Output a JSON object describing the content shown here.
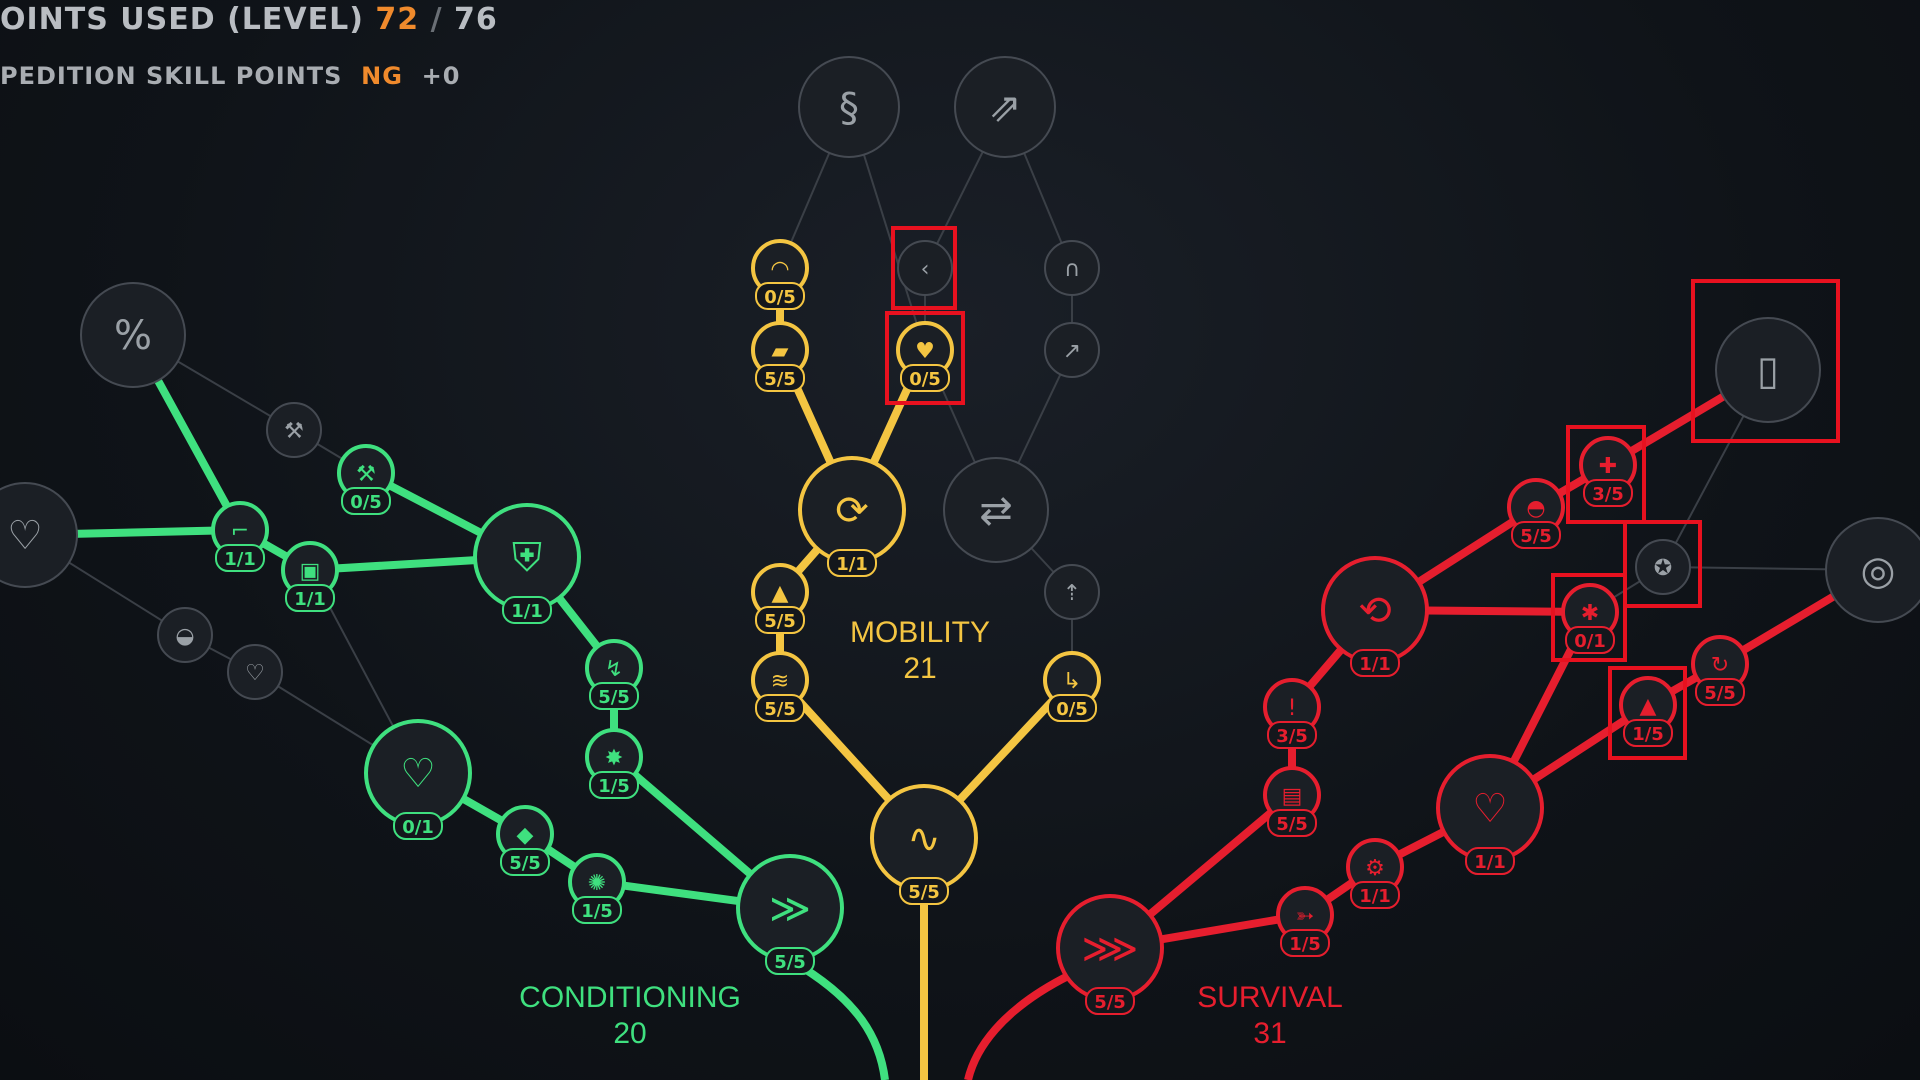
{
  "hud": {
    "points_label": "OINTS USED (LEVEL)",
    "points_used": "72",
    "points_sep": "/",
    "points_total": "76",
    "exp_label": "PEDITION SKILL POINTS",
    "exp_value": "NG",
    "exp_bonus": "+0"
  },
  "branches": {
    "mobility": {
      "name": "MOBILITY",
      "points": "21"
    },
    "conditioning": {
      "name": "CONDITIONING",
      "points": "20"
    },
    "survival": {
      "name": "SURVIVAL",
      "points": "31"
    }
  },
  "colors": {
    "mobility": "#f4c542",
    "conditioning": "#3fe07f",
    "survival": "#e61e2e",
    "locked": "#4a4f57",
    "highlight_box": "#e8111f"
  },
  "nodes": [
    {
      "id": "m-top-left",
      "branch": "locked",
      "icon": "zigzag-s-icon",
      "label": ""
    },
    {
      "id": "m-top-right",
      "branch": "locked",
      "icon": "dash-arrow-icon",
      "label": ""
    },
    {
      "id": "m1",
      "branch": "mobility",
      "icon": "arc-icon",
      "label": "0/5"
    },
    {
      "id": "m2",
      "branch": "locked",
      "icon": "chevron-left-icon",
      "label": ""
    },
    {
      "id": "m3",
      "branch": "locked",
      "icon": "magnet-icon",
      "label": ""
    },
    {
      "id": "m4",
      "branch": "mobility",
      "icon": "shoe-icon",
      "label": "5/5"
    },
    {
      "id": "m5",
      "branch": "mobility",
      "icon": "heart-wing-icon",
      "label": "0/5"
    },
    {
      "id": "m6",
      "branch": "locked",
      "icon": "pin-icon",
      "label": ""
    },
    {
      "id": "m-big-1",
      "branch": "mobility",
      "icon": "swirl-arrow-icon",
      "label": "1/1"
    },
    {
      "id": "m-big-2",
      "branch": "locked",
      "icon": "cycle-arrow-icon",
      "label": ""
    },
    {
      "id": "m7",
      "branch": "mobility",
      "icon": "boot-icon",
      "label": "5/5"
    },
    {
      "id": "m8",
      "branch": "locked",
      "icon": "jump-icon",
      "label": ""
    },
    {
      "id": "m9",
      "branch": "mobility",
      "icon": "coil-icon",
      "label": "5/5"
    },
    {
      "id": "m10",
      "branch": "mobility",
      "icon": "slide-icon",
      "label": "0/5"
    },
    {
      "id": "m-root",
      "branch": "mobility",
      "icon": "wave-arrow-icon",
      "label": "5/5"
    },
    {
      "id": "c-top",
      "branch": "locked",
      "icon": "percent-icon",
      "label": ""
    },
    {
      "id": "c-heart-left",
      "branch": "locked",
      "icon": "heart-shield-icon",
      "label": ""
    },
    {
      "id": "c1",
      "branch": "locked",
      "icon": "pickaxe-icon",
      "label": ""
    },
    {
      "id": "c2",
      "branch": "conditioning",
      "icon": "hammer-icon",
      "label": "0/5"
    },
    {
      "id": "c3",
      "branch": "conditioning",
      "icon": "pistol-icon",
      "label": "1/1"
    },
    {
      "id": "c4",
      "branch": "conditioning",
      "icon": "crate-icon",
      "label": "1/1"
    },
    {
      "id": "c-big-shield",
      "branch": "conditioning",
      "icon": "shield-icon",
      "label": "1/1"
    },
    {
      "id": "c5",
      "branch": "locked",
      "icon": "turtle-icon",
      "label": ""
    },
    {
      "id": "c6",
      "branch": "locked",
      "icon": "heart-icon",
      "label": ""
    },
    {
      "id": "c7",
      "branch": "conditioning",
      "icon": "leap-icon",
      "label": "5/5"
    },
    {
      "id": "c8",
      "branch": "conditioning",
      "icon": "spike-icon",
      "label": "1/5"
    },
    {
      "id": "c-big-heart",
      "branch": "conditioning",
      "icon": "heart-split-icon",
      "label": "0/1"
    },
    {
      "id": "c9",
      "branch": "conditioning",
      "icon": "gem-icon",
      "label": "5/5"
    },
    {
      "id": "c10",
      "branch": "conditioning",
      "icon": "sun-icon",
      "label": "1/5"
    },
    {
      "id": "c-root",
      "branch": "conditioning",
      "icon": "feather-icon",
      "label": "5/5"
    },
    {
      "id": "s-top",
      "branch": "locked",
      "icon": "door-icon",
      "label": ""
    },
    {
      "id": "s-right",
      "branch": "locked",
      "icon": "target-icon",
      "label": ""
    },
    {
      "id": "s1",
      "branch": "survival",
      "icon": "medkit-icon",
      "label": "3/5"
    },
    {
      "id": "s2",
      "branch": "survival",
      "icon": "helmet-icon",
      "label": "5/5"
    },
    {
      "id": "s3",
      "branch": "locked",
      "icon": "badge-icon",
      "label": ""
    },
    {
      "id": "s-big-1",
      "branch": "survival",
      "icon": "reload-icon",
      "label": "1/1"
    },
    {
      "id": "s4",
      "branch": "survival",
      "icon": "bug-icon",
      "label": "0/1"
    },
    {
      "id": "s5",
      "branch": "survival",
      "icon": "spin-icon",
      "label": "5/5"
    },
    {
      "id": "s6",
      "branch": "survival",
      "icon": "alert-icon",
      "label": "3/5"
    },
    {
      "id": "s7",
      "branch": "survival",
      "icon": "flame-icon",
      "label": "1/5"
    },
    {
      "id": "s8",
      "branch": "survival",
      "icon": "bag-icon",
      "label": "5/5"
    },
    {
      "id": "s-big-heart",
      "branch": "survival",
      "icon": "heart-pulse-icon",
      "label": "1/1"
    },
    {
      "id": "s9",
      "branch": "survival",
      "icon": "wrench-icon",
      "label": "1/1"
    },
    {
      "id": "s10",
      "branch": "survival",
      "icon": "gun-icon",
      "label": "1/5"
    },
    {
      "id": "s-root",
      "branch": "survival",
      "icon": "arrows-icon",
      "label": "5/5"
    }
  ]
}
